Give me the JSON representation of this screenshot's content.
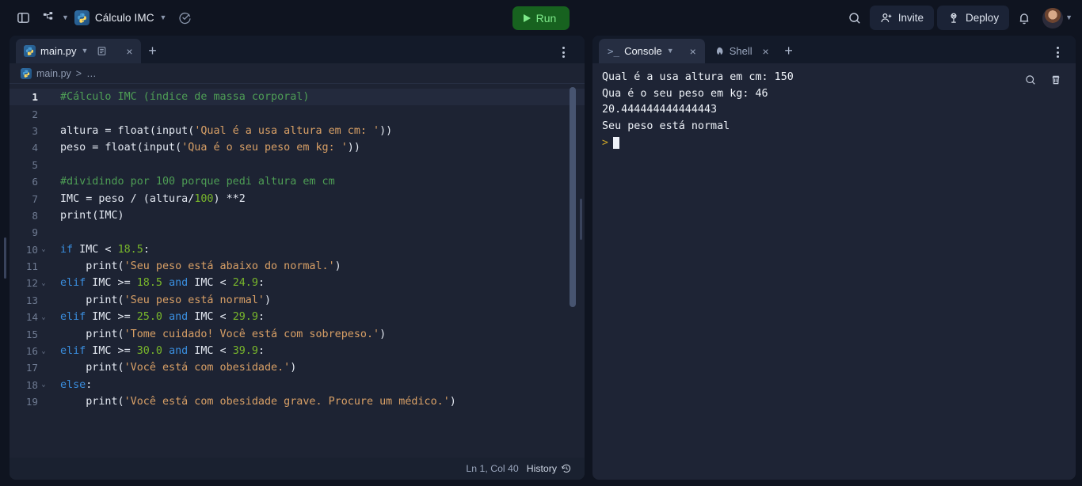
{
  "topbar": {
    "sidebar_toggle": "sidebar-toggle",
    "tree_label": "tree-menu",
    "project_name": "Cálculo IMC",
    "run_label": "Run",
    "invite_label": "Invite",
    "deploy_label": "Deploy",
    "search_icon": "search-icon",
    "bell_icon": "notifications-icon",
    "status_icon": "check-circle-icon"
  },
  "editor": {
    "tab": {
      "filename": "main.py",
      "close": "×"
    },
    "new_tab": "+",
    "breadcrumb": {
      "file": "main.py",
      "separator": ">",
      "rest": "…"
    },
    "status": {
      "position": "Ln 1, Col 40",
      "history": "History"
    },
    "lines": [
      {
        "n": "1",
        "fold": "",
        "active": true,
        "tokens": [
          {
            "t": "com",
            "v": "#Cálculo IMC (índice de massa corporal)"
          }
        ]
      },
      {
        "n": "2",
        "fold": "",
        "tokens": []
      },
      {
        "n": "3",
        "fold": "",
        "tokens": [
          {
            "t": "pl",
            "v": "altura = float(input("
          },
          {
            "t": "str",
            "v": "'Qual é a usa altura em cm: '"
          },
          {
            "t": "pl",
            "v": "))"
          }
        ]
      },
      {
        "n": "4",
        "fold": "",
        "tokens": [
          {
            "t": "pl",
            "v": "peso = float(input("
          },
          {
            "t": "str",
            "v": "'Qua é o seu peso em kg: '"
          },
          {
            "t": "pl",
            "v": "))"
          }
        ]
      },
      {
        "n": "5",
        "fold": "",
        "tokens": []
      },
      {
        "n": "6",
        "fold": "",
        "tokens": [
          {
            "t": "com",
            "v": "#dividindo por 100 porque pedi altura em cm"
          }
        ]
      },
      {
        "n": "7",
        "fold": "",
        "tokens": [
          {
            "t": "pl",
            "v": "IMC = peso / (altura/"
          },
          {
            "t": "num",
            "v": "100"
          },
          {
            "t": "pl",
            "v": ") **2"
          }
        ]
      },
      {
        "n": "8",
        "fold": "",
        "tokens": [
          {
            "t": "pl",
            "v": "print(IMC)"
          }
        ]
      },
      {
        "n": "9",
        "fold": "",
        "tokens": []
      },
      {
        "n": "10",
        "fold": "v",
        "tokens": [
          {
            "t": "kw",
            "v": "if"
          },
          {
            "t": "pl",
            "v": " IMC < "
          },
          {
            "t": "num",
            "v": "18.5"
          },
          {
            "t": "pl",
            "v": ":"
          }
        ]
      },
      {
        "n": "11",
        "fold": "",
        "tokens": [
          {
            "t": "pl",
            "v": "    print("
          },
          {
            "t": "str",
            "v": "'Seu peso está abaixo do normal.'"
          },
          {
            "t": "pl",
            "v": ")"
          }
        ]
      },
      {
        "n": "12",
        "fold": "v",
        "tokens": [
          {
            "t": "kw",
            "v": "elif"
          },
          {
            "t": "pl",
            "v": " IMC >= "
          },
          {
            "t": "num",
            "v": "18.5"
          },
          {
            "t": "pl",
            "v": " "
          },
          {
            "t": "kw",
            "v": "and"
          },
          {
            "t": "pl",
            "v": " IMC < "
          },
          {
            "t": "num",
            "v": "24.9"
          },
          {
            "t": "pl",
            "v": ":"
          }
        ]
      },
      {
        "n": "13",
        "fold": "",
        "tokens": [
          {
            "t": "pl",
            "v": "    print("
          },
          {
            "t": "str",
            "v": "'Seu peso está normal'"
          },
          {
            "t": "pl",
            "v": ")"
          }
        ]
      },
      {
        "n": "14",
        "fold": "v",
        "tokens": [
          {
            "t": "kw",
            "v": "elif"
          },
          {
            "t": "pl",
            "v": " IMC >= "
          },
          {
            "t": "num",
            "v": "25.0"
          },
          {
            "t": "pl",
            "v": " "
          },
          {
            "t": "kw",
            "v": "and"
          },
          {
            "t": "pl",
            "v": " IMC < "
          },
          {
            "t": "num",
            "v": "29.9"
          },
          {
            "t": "pl",
            "v": ":"
          }
        ]
      },
      {
        "n": "15",
        "fold": "",
        "tokens": [
          {
            "t": "pl",
            "v": "    print("
          },
          {
            "t": "str",
            "v": "'Tome cuidado! Você está com sobrepeso.'"
          },
          {
            "t": "pl",
            "v": ")"
          }
        ]
      },
      {
        "n": "16",
        "fold": "v",
        "tokens": [
          {
            "t": "kw",
            "v": "elif"
          },
          {
            "t": "pl",
            "v": " IMC >= "
          },
          {
            "t": "num",
            "v": "30.0"
          },
          {
            "t": "pl",
            "v": " "
          },
          {
            "t": "kw",
            "v": "and"
          },
          {
            "t": "pl",
            "v": " IMC < "
          },
          {
            "t": "num",
            "v": "39.9"
          },
          {
            "t": "pl",
            "v": ":"
          }
        ]
      },
      {
        "n": "17",
        "fold": "",
        "tokens": [
          {
            "t": "pl",
            "v": "    print("
          },
          {
            "t": "str",
            "v": "'Você está com obesidade.'"
          },
          {
            "t": "pl",
            "v": ")"
          }
        ]
      },
      {
        "n": "18",
        "fold": "v",
        "tokens": [
          {
            "t": "kw",
            "v": "else"
          },
          {
            "t": "pl",
            "v": ":"
          }
        ]
      },
      {
        "n": "19",
        "fold": "",
        "tokens": [
          {
            "t": "pl",
            "v": "    print("
          },
          {
            "t": "str",
            "v": "'Você está com obesidade grave. Procure um médico.'"
          },
          {
            "t": "pl",
            "v": ")"
          }
        ]
      }
    ]
  },
  "console": {
    "tabs": [
      {
        "label": "Console",
        "selected": true,
        "icon": "terminal-prompt-icon",
        "close": "×"
      },
      {
        "label": "Shell",
        "selected": false,
        "icon": "shell-icon",
        "close": "×"
      }
    ],
    "new_tab": "+",
    "output": [
      "Qual é a usa altura em cm: 150",
      "Qua é o seu peso em kg: 46",
      "20.444444444444443",
      "Seu peso está normal"
    ],
    "prompt_symbol": ">",
    "tools": {
      "search": "search-icon",
      "clear": "trash-icon"
    }
  },
  "colors": {
    "chrome_bg": "#0f1420",
    "panel_bg": "#1d2333",
    "console_bg": "#1e2435",
    "run_green": "#17621f",
    "run_text": "#7ee98a",
    "comment": "#4e9e55",
    "string": "#d9a066",
    "number": "#79b72b",
    "keyword": "#3a8fe0"
  }
}
